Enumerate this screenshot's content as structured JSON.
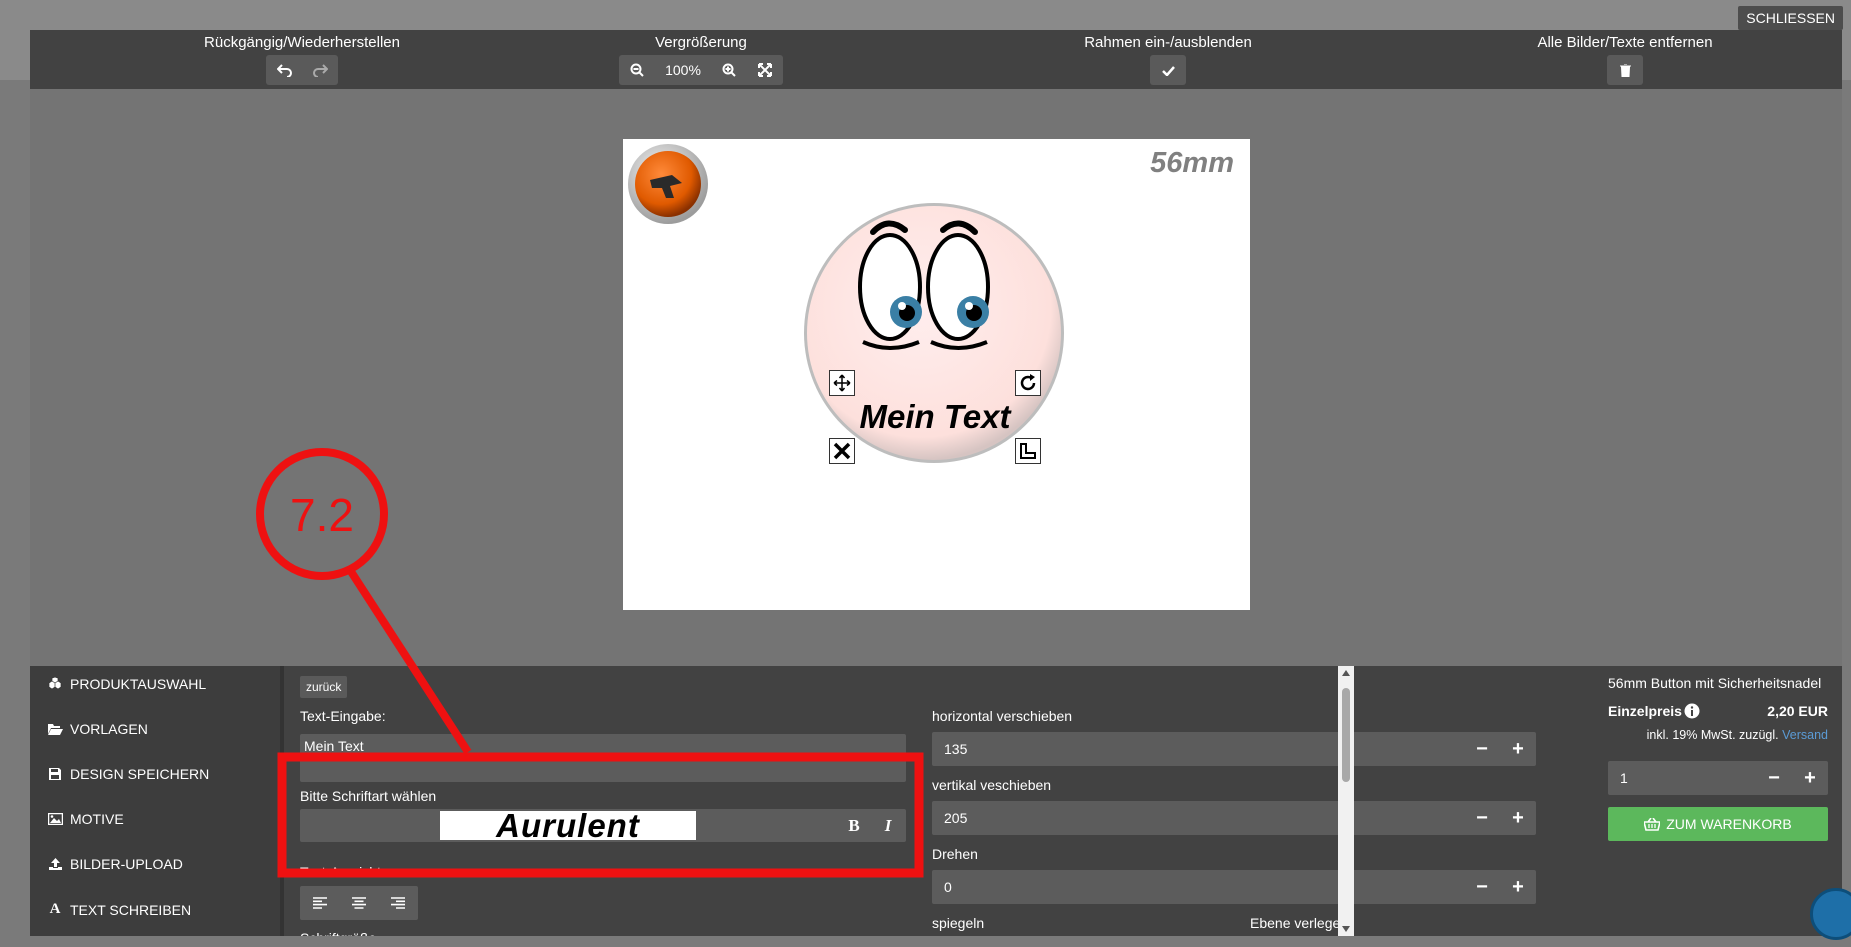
{
  "close_label": "SCHLIESSEN",
  "toolbar": {
    "undo_group_label": "Rückgängig/Wiederherstellen",
    "zoom_group_label": "Vergrößerung",
    "zoom_value": "100%",
    "frame_group_label": "Rahmen ein-/ausblenden",
    "remove_group_label": "Alle Bilder/Texte entfernen"
  },
  "canvas": {
    "size_label": "56mm",
    "text_object": "Mein Text"
  },
  "sidebar": {
    "items": [
      {
        "label": "PRODUKTAUSWAHL",
        "icon": "cubes-icon"
      },
      {
        "label": "VORLAGEN",
        "icon": "folder-open-icon"
      },
      {
        "label": "DESIGN SPEICHERN",
        "icon": "floppy-disk-icon"
      },
      {
        "label": "MOTIVE",
        "icon": "image-icon"
      },
      {
        "label": "BILDER-UPLOAD",
        "icon": "upload-icon"
      },
      {
        "label": "TEXT SCHREIBEN",
        "icon": "font-icon"
      }
    ]
  },
  "text_panel": {
    "back_label": "zurück",
    "input_label": "Text-Eingabe:",
    "input_value": "Mein Text",
    "font_label": "Bitte Schriftart wählen",
    "font_value": "Aurulent",
    "bold_label": "B",
    "italic_label": "I",
    "align_label": "Text-Ausrichtung",
    "size_label": "Schriftgröße",
    "h_label": "horizontal verschieben",
    "h_value": "135",
    "v_label": "vertikal veschieben",
    "v_value": "205",
    "rotate_label": "Drehen",
    "rotate_value": "0",
    "mirror_label": "spiegeln",
    "layer_label": "Ebene verlegen"
  },
  "cart": {
    "product_name": "56mm Button mit Sicherheitsnadel",
    "unit_price_label": "Einzelpreis",
    "unit_price_value": "2,20 EUR",
    "tax_note": "inkl. 19% MwSt. zuzügl.",
    "shipping_link": "Versand",
    "quantity": "1",
    "add_to_cart_label": "ZUM WARENKORB"
  },
  "annotation": {
    "label": "7.2",
    "color": "#ee1111"
  }
}
